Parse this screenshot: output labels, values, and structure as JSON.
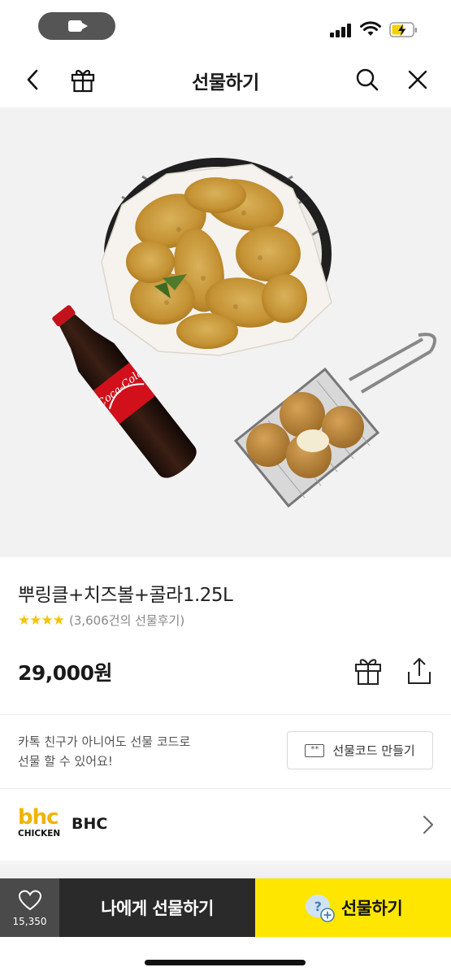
{
  "nav": {
    "title": "선물하기"
  },
  "product": {
    "name": "뿌링클+치즈볼+콜라1.25L",
    "stars": "★★★★",
    "review_count": "(3,606건의 선물후기)",
    "price": "29,000원"
  },
  "gift_code": {
    "info_line1": "카톡 친구가 아니어도 선물 코드로",
    "info_line2": "선물 할 수 있어요!",
    "button_label": "선물코드 만들기",
    "ticket_glyph": "**"
  },
  "brand": {
    "logo_text": "bhc",
    "logo_subtext": "CHICKEN",
    "name": "BHC"
  },
  "bottom_bar": {
    "wish_count": "15,350",
    "self_gift_label": "나에게 선물하기",
    "gift_label": "선물하기"
  },
  "product_image": {
    "bottle_label": "Coca-Cola"
  },
  "colors": {
    "accent_yellow": "#ffe600",
    "dark_button": "#2a2a2a",
    "star": "#f5c400",
    "brand_yellow": "#f0b400"
  },
  "icons": [
    "back-icon",
    "gift-icon",
    "search-icon",
    "close-icon",
    "share-icon",
    "heart-icon",
    "chevron-right-icon",
    "ticket-icon"
  ]
}
